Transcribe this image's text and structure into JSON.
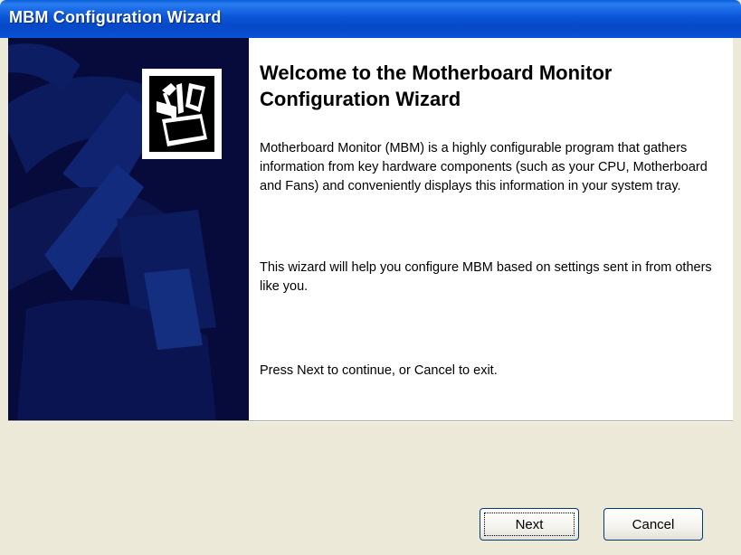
{
  "window": {
    "title": "MBM Configuration Wizard"
  },
  "content": {
    "heading": "Welcome to the Motherboard Monitor Configuration Wizard",
    "paragraphs": [
      "Motherboard Monitor (MBM) is a highly configurable program that gathers information from key hardware components (such as your CPU, Motherboard and Fans) and conveniently displays this information in your system tray.",
      "This wizard will help you configure MBM based on settings sent in from others like you.",
      "Press Next to continue, or Cancel to exit."
    ]
  },
  "buttons": {
    "next": "Next",
    "cancel": "Cancel"
  },
  "icons": {
    "wizard_logo": "toolbox-folder-icon"
  },
  "colors": {
    "titlebar": "#0a55d8",
    "side_panel": "#060b3c",
    "dialog_face": "#ece9d8"
  }
}
